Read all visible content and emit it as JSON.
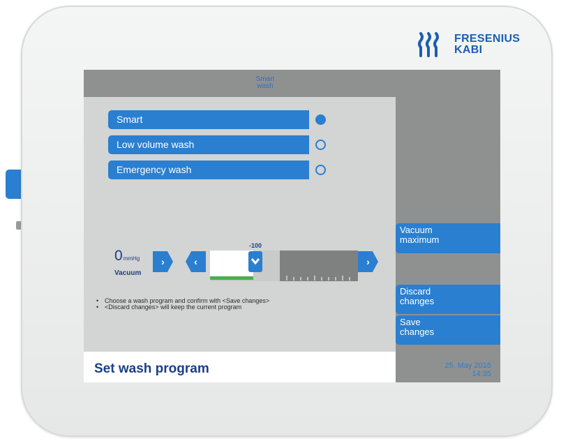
{
  "brand": {
    "line1": "FRESENIUS",
    "line2": "KABI",
    "color": "#1b5eb0"
  },
  "screen": {
    "top_title_line1": "Smart",
    "top_title_line2": "wash",
    "programs": [
      {
        "label": "Smart",
        "selected": true
      },
      {
        "label": "Low volume wash",
        "selected": false
      },
      {
        "label": "Emergency wash",
        "selected": false
      }
    ],
    "vacuum": {
      "value": "0",
      "unit": "mmHg",
      "label": "Vacuum"
    },
    "slider": {
      "value_label": "-100",
      "position_fraction": 0.47
    },
    "hints": [
      "Choose a wash program and confirm with <Save changes>",
      "<Discard changes> will keep the current program"
    ],
    "actions": {
      "vacuum_maximum_line1": "Vacuum",
      "vacuum_maximum_line2": "maximum",
      "discard_line1": "Discard",
      "discard_line2": "changes",
      "save_line1": "Save",
      "save_line2": "changes"
    },
    "page_title": "Set wash program",
    "date": "25. May 2016",
    "time": "14:35"
  },
  "colors": {
    "accent": "#2a7fd0",
    "panel": "#d3d4d4",
    "bar": "#8f9191"
  }
}
